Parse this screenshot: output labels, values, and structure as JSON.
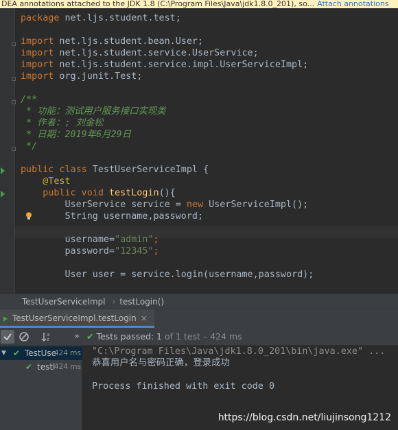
{
  "banner": {
    "text": "DEA annotations attached to the JDK 1.8 (C:\\Program Files\\Java\\jdk1.8.0_201), so...",
    "link": "Attach annotations"
  },
  "code": {
    "package_kw": "package",
    "package_name": " net.ljs.student.test;",
    "import_kw": "import",
    "imports": [
      " net.ljs.student.bean.User;",
      " net.ljs.student.service.UserService;",
      " net.ljs.student.service.impl.UserServiceImpl;",
      " org.junit.Test;"
    ],
    "javadoc": [
      "/**",
      " * 功能：测试用户服务接口实现类",
      " * 作者：; 刘金松",
      " * 日期：2019年6月29日",
      " */"
    ],
    "class_kw": "public class",
    "class_name": " TestUserServiceImpl {",
    "annotation": "@Test",
    "method_kw": "public void",
    "method_name": "testLogin",
    "method_tail": "(){",
    "l_service_a": "UserService service = ",
    "l_service_new": "new",
    "l_service_b": " UserServiceImpl();",
    "l_decl": "String username,password;",
    "l_user_a": "username=",
    "l_user_v": "\"admin\"",
    "l_pass_a": "password=",
    "l_pass_v": "\"12345\"",
    "l_login": "User user = service.login(username,password);",
    "semi": ";"
  },
  "breadcrumb": {
    "items": [
      "TestUserServiceImpl",
      "testLogin()"
    ]
  },
  "run_tab": {
    "label": "TestUserServiceImpl.testLogin",
    "close": "×"
  },
  "toolbar": {
    "expand": "»",
    "status_label": "Tests passed:",
    "status_count": "1",
    "status_rest": "of 1 test – 424 ms"
  },
  "tree": [
    {
      "name": "TestUse",
      "time": "424 ms"
    },
    {
      "name": "testl",
      "time": "424 ms"
    }
  ],
  "console": {
    "lines": [
      "\"C:\\Program Files\\Java\\jdk1.8.0_201\\bin\\java.exe\" ...",
      "恭喜用户名与密码正确，登录成功",
      "",
      "Process finished with exit code 0"
    ],
    "watermark": "https://blog.csdn.net/liujinsong1212"
  },
  "colors": {
    "keyword": "#cc7832",
    "string": "#6a8759",
    "annotation": "#bbb529",
    "comment": "#629755",
    "pass": "#5fb061"
  }
}
